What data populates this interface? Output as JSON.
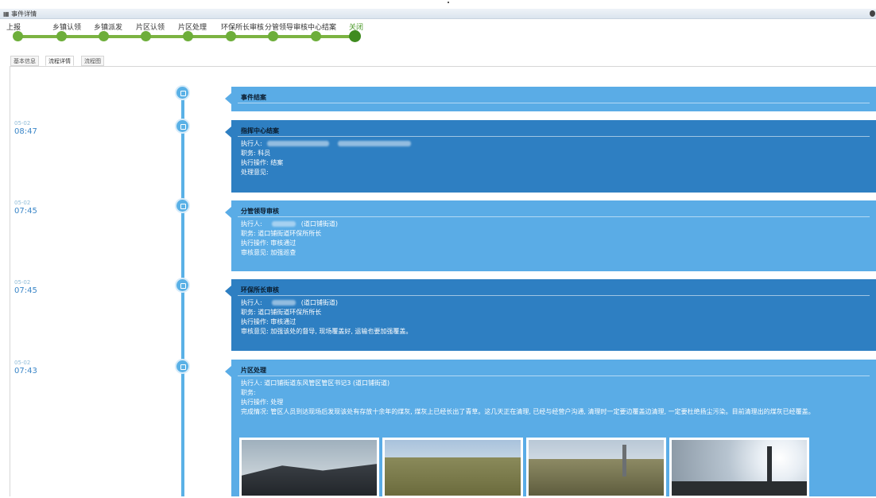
{
  "window": {
    "title": "事件详情"
  },
  "steps": [
    {
      "label": "上报",
      "active": false
    },
    {
      "label": "乡镇认领",
      "active": false
    },
    {
      "label": "乡镇派发",
      "active": false
    },
    {
      "label": "片区认领",
      "active": false
    },
    {
      "label": "片区处理",
      "active": false
    },
    {
      "label": "环保所长审核",
      "active": false
    },
    {
      "label": "分管领导审核",
      "active": false
    },
    {
      "label": "中心结案",
      "active": false
    },
    {
      "label": "关闭",
      "active": true
    }
  ],
  "tabs": [
    {
      "label": "基本信息",
      "active": false
    },
    {
      "label": "流程详情",
      "active": true
    },
    {
      "label": "流程图",
      "active": false
    }
  ],
  "timeline": [
    {
      "title": "事件结案"
    },
    {
      "date": "05-02",
      "time": "08:47",
      "title": "指挥中心结案",
      "executor_label": "执行人:",
      "position": "职务: 科员",
      "operation": "执行操作: 结案",
      "opinion": "处理意见:"
    },
    {
      "date": "05-02",
      "time": "07:45",
      "title": "分管领导审核",
      "executor_label": "执行人:",
      "executor_org": "(道口铺街道)",
      "position": "职务: 道口铺街道环保所所长",
      "operation": "执行操作: 审核通过",
      "opinion": "审核意见: 加强巡查"
    },
    {
      "date": "05-02",
      "time": "07:45",
      "title": "环保所长审核",
      "executor_label": "执行人:",
      "executor_org": "(道口铺街道)",
      "position": "职务: 道口铺街道环保所所长",
      "operation": "执行操作: 审核通过",
      "opinion": "审核意见: 加强该处的督导, 现场覆盖好, 运输也要加强覆盖。"
    },
    {
      "date": "05-02",
      "time": "07:43",
      "title": "片区处理",
      "executor": "执行人: 道口铺街道东风管区管区书记3 (道口铺街道)",
      "position": "职务:",
      "operation": "执行操作: 处理",
      "situation": "完成情况: 管区人员到达现场后发现该处有存放十余年的煤灰, 煤灰上已经长出了青草。这几天正在清理, 已经与经营户沟通, 清理时一定要边覆盖边清理, 一定要杜绝扬尘污染。目前清理出的煤灰已经覆盖。"
    }
  ],
  "colors": {
    "progress_green": "#6dae3a",
    "active_green": "#3f8b1f",
    "timeline_blue": "#5ab1e6",
    "card_light": "#5aace6",
    "card_dark": "#2e7fc2"
  }
}
